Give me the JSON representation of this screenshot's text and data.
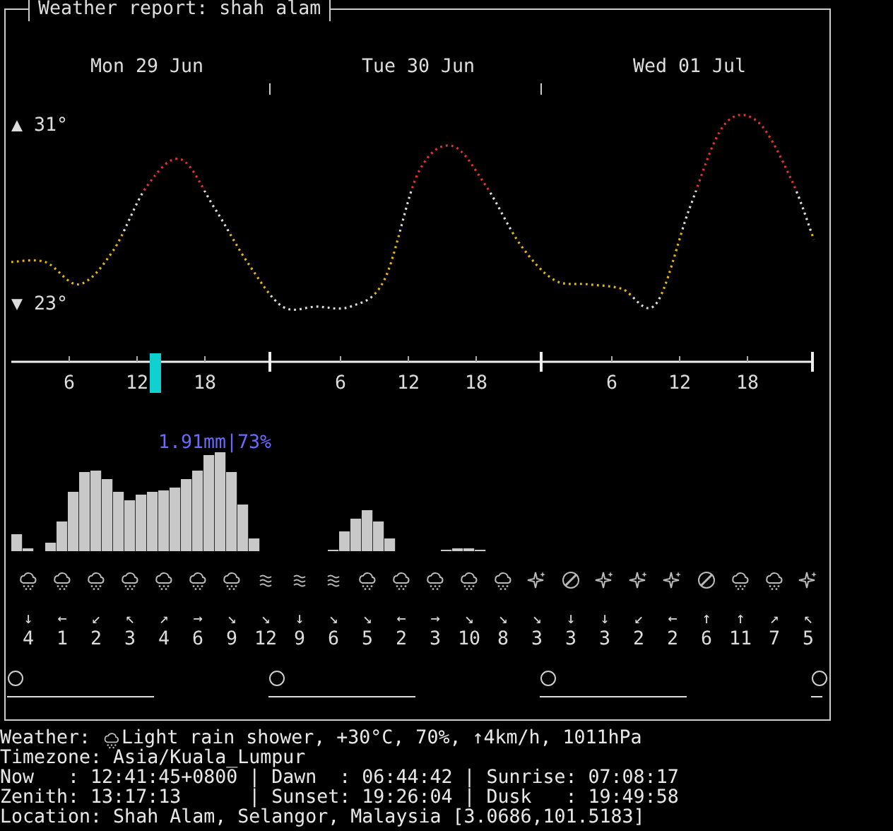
{
  "window": {
    "title": "Weather report: shah alam"
  },
  "days": [
    "Mon 29 Jun",
    "Tue 30 Jun",
    "Wed 01 Jul"
  ],
  "temperature": {
    "max_label": "▲ 31°",
    "min_label": "▼ 23°"
  },
  "time_axis": {
    "ticks": [
      {
        "label": "6"
      },
      {
        "label": "12"
      },
      {
        "label": "18"
      },
      {
        "label": "6"
      },
      {
        "label": "12"
      },
      {
        "label": "18"
      },
      {
        "label": "6"
      },
      {
        "label": "12"
      },
      {
        "label": "18"
      }
    ],
    "now": {
      "level": 0.184
    }
  },
  "precipitation": {
    "summary": "1.91mm|73%"
  },
  "forecast": [
    {
      "kind": "shower",
      "arrow": "↓",
      "speed": "4"
    },
    {
      "kind": "shower",
      "arrow": "←",
      "speed": "1"
    },
    {
      "kind": "shower",
      "arrow": "↙",
      "speed": "2"
    },
    {
      "kind": "shower",
      "arrow": "↖",
      "speed": "3"
    },
    {
      "kind": "shower",
      "arrow": "↗",
      "speed": "4"
    },
    {
      "kind": "shower",
      "arrow": "→",
      "speed": "6"
    },
    {
      "kind": "shower",
      "arrow": "↘",
      "speed": "9"
    },
    {
      "kind": "mist",
      "arrow": "↘",
      "speed": "12"
    },
    {
      "kind": "mist",
      "arrow": "↓",
      "speed": "9"
    },
    {
      "kind": "mist",
      "arrow": "↘",
      "speed": "6"
    },
    {
      "kind": "shower",
      "arrow": "↘",
      "speed": "5"
    },
    {
      "kind": "shower",
      "arrow": "←",
      "speed": "2"
    },
    {
      "kind": "shower",
      "arrow": "→",
      "speed": "3"
    },
    {
      "kind": "shower",
      "arrow": "↘",
      "speed": "10"
    },
    {
      "kind": "shower",
      "arrow": "↘",
      "speed": "8"
    },
    {
      "kind": "clear",
      "arrow": "↘",
      "speed": "3"
    },
    {
      "kind": "crossed",
      "arrow": "↓",
      "speed": "3"
    },
    {
      "kind": "clear",
      "arrow": "↓",
      "speed": "3"
    },
    {
      "kind": "clear",
      "arrow": "↙",
      "speed": "2"
    },
    {
      "kind": "clear",
      "arrow": "←",
      "speed": "2"
    },
    {
      "kind": "crossed",
      "arrow": "↑",
      "speed": "6"
    },
    {
      "kind": "shower",
      "arrow": "↑",
      "speed": "11"
    },
    {
      "kind": "shower",
      "arrow": "↗",
      "speed": "7"
    },
    {
      "kind": "clear",
      "arrow": "↖",
      "speed": "5"
    }
  ],
  "details": {
    "label": "Weather:",
    "kind": "shower",
    "summary": "Light rain shower, +30°C, 70%, ↑4km/h, 1011hPa",
    "lines": [
      "Timezone: Asia/Kuala_Lumpur",
      "Now   : 12:41:45+0800 | Dawn  : 06:44:42 | Sunrise: 07:08:17",
      "Zenith: 13:17:13      | Sunset: 19:26:04 | Dusk   : 19:49:58",
      "Location: Shah Alam, Selangor, Malaysia [3.0686,101.5183]"
    ]
  }
}
